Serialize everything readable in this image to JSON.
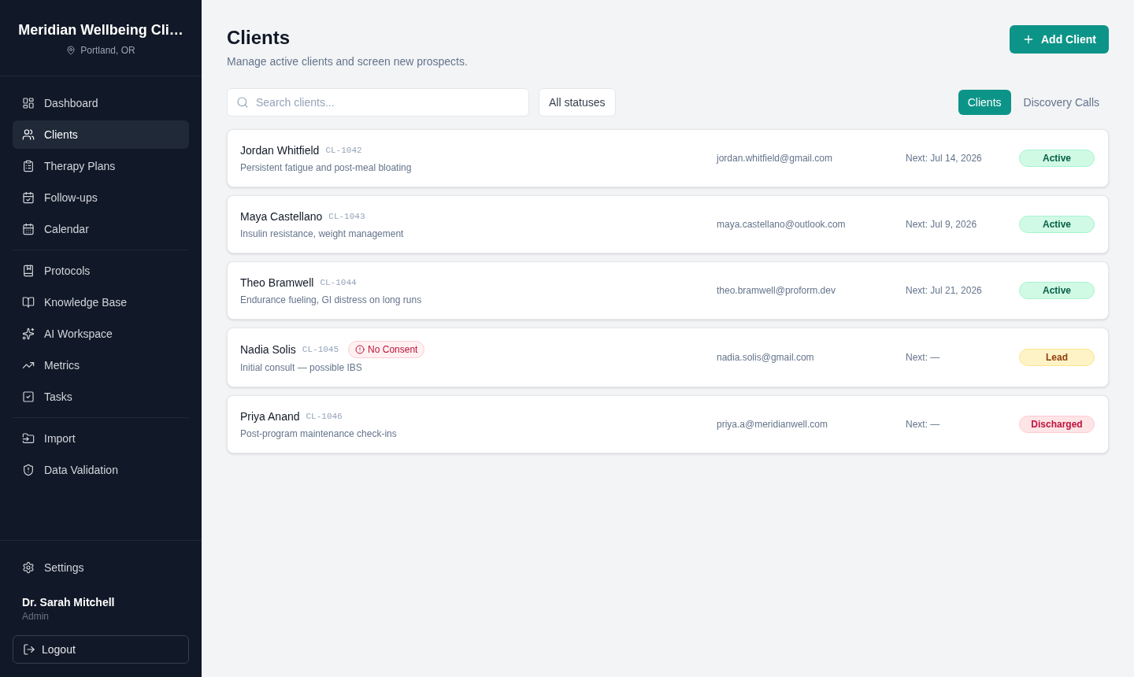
{
  "sidebar": {
    "clinic_name": "Meridian Wellbeing Cli…",
    "location": "Portland, OR",
    "nav_groups": [
      {
        "items": [
          {
            "label": "Dashboard",
            "selected": false
          },
          {
            "label": "Clients",
            "selected": true
          },
          {
            "label": "Therapy Plans",
            "selected": false
          },
          {
            "label": "Follow-ups",
            "selected": false
          },
          {
            "label": "Calendar",
            "selected": false
          }
        ]
      },
      {
        "items": [
          {
            "label": "Protocols",
            "selected": false
          },
          {
            "label": "Knowledge Base",
            "selected": false
          },
          {
            "label": "AI Workspace",
            "selected": false
          },
          {
            "label": "Metrics",
            "selected": false
          },
          {
            "label": "Tasks",
            "selected": false
          }
        ]
      },
      {
        "items": [
          {
            "label": "Import",
            "selected": false
          },
          {
            "label": "Data Validation",
            "selected": false
          }
        ]
      }
    ],
    "settings": "Settings",
    "user": {
      "name": "Dr. Sarah Mitchell",
      "role": "Admin"
    },
    "logout_button": "Logout"
  },
  "header": {
    "title": "Clients",
    "subtitle": "Manage active clients and screen new prospects.",
    "add_button": "Add Client"
  },
  "toolbar": {
    "search": {
      "placeholder": "Search clients..."
    },
    "status_filter": "All statuses",
    "tabs": [
      {
        "label": "Clients",
        "selected": true
      },
      {
        "label": "Discovery Calls",
        "selected": false
      }
    ]
  },
  "clients": [
    {
      "name": "Jordan Whitfield",
      "id": "CL-1042",
      "summary": "Persistent fatigue and post-meal bloating",
      "email": "jordan.whitfield@gmail.com",
      "next": "Next: Jul 14, 2026",
      "status": {
        "label": "Active",
        "kind": "active"
      }
    },
    {
      "name": "Maya Castellano",
      "id": "CL-1043",
      "summary": "Insulin resistance, weight management",
      "email": "maya.castellano@outlook.com",
      "next": "Next: Jul 9, 2026",
      "status": {
        "label": "Active",
        "kind": "active"
      }
    },
    {
      "name": "Theo Bramwell",
      "id": "CL-1044",
      "summary": "Endurance fueling, GI distress on long runs",
      "email": "theo.bramwell@proform.dev",
      "next": "Next: Jul 21, 2026",
      "status": {
        "label": "Active",
        "kind": "active"
      }
    },
    {
      "name": "Nadia Solis",
      "id": "CL-1045",
      "flag": "No Consent",
      "summary": "Initial consult — possible IBS",
      "email": "nadia.solis@gmail.com",
      "next": "Next: —",
      "status": {
        "label": "Lead",
        "kind": "lead"
      }
    },
    {
      "name": "Priya Anand",
      "id": "CL-1046",
      "summary": "Post-program maintenance check-ins",
      "email": "priya.a@meridianwell.com",
      "next": "Next: —",
      "status": {
        "label": "Discharged",
        "kind": "discharged"
      }
    }
  ]
}
